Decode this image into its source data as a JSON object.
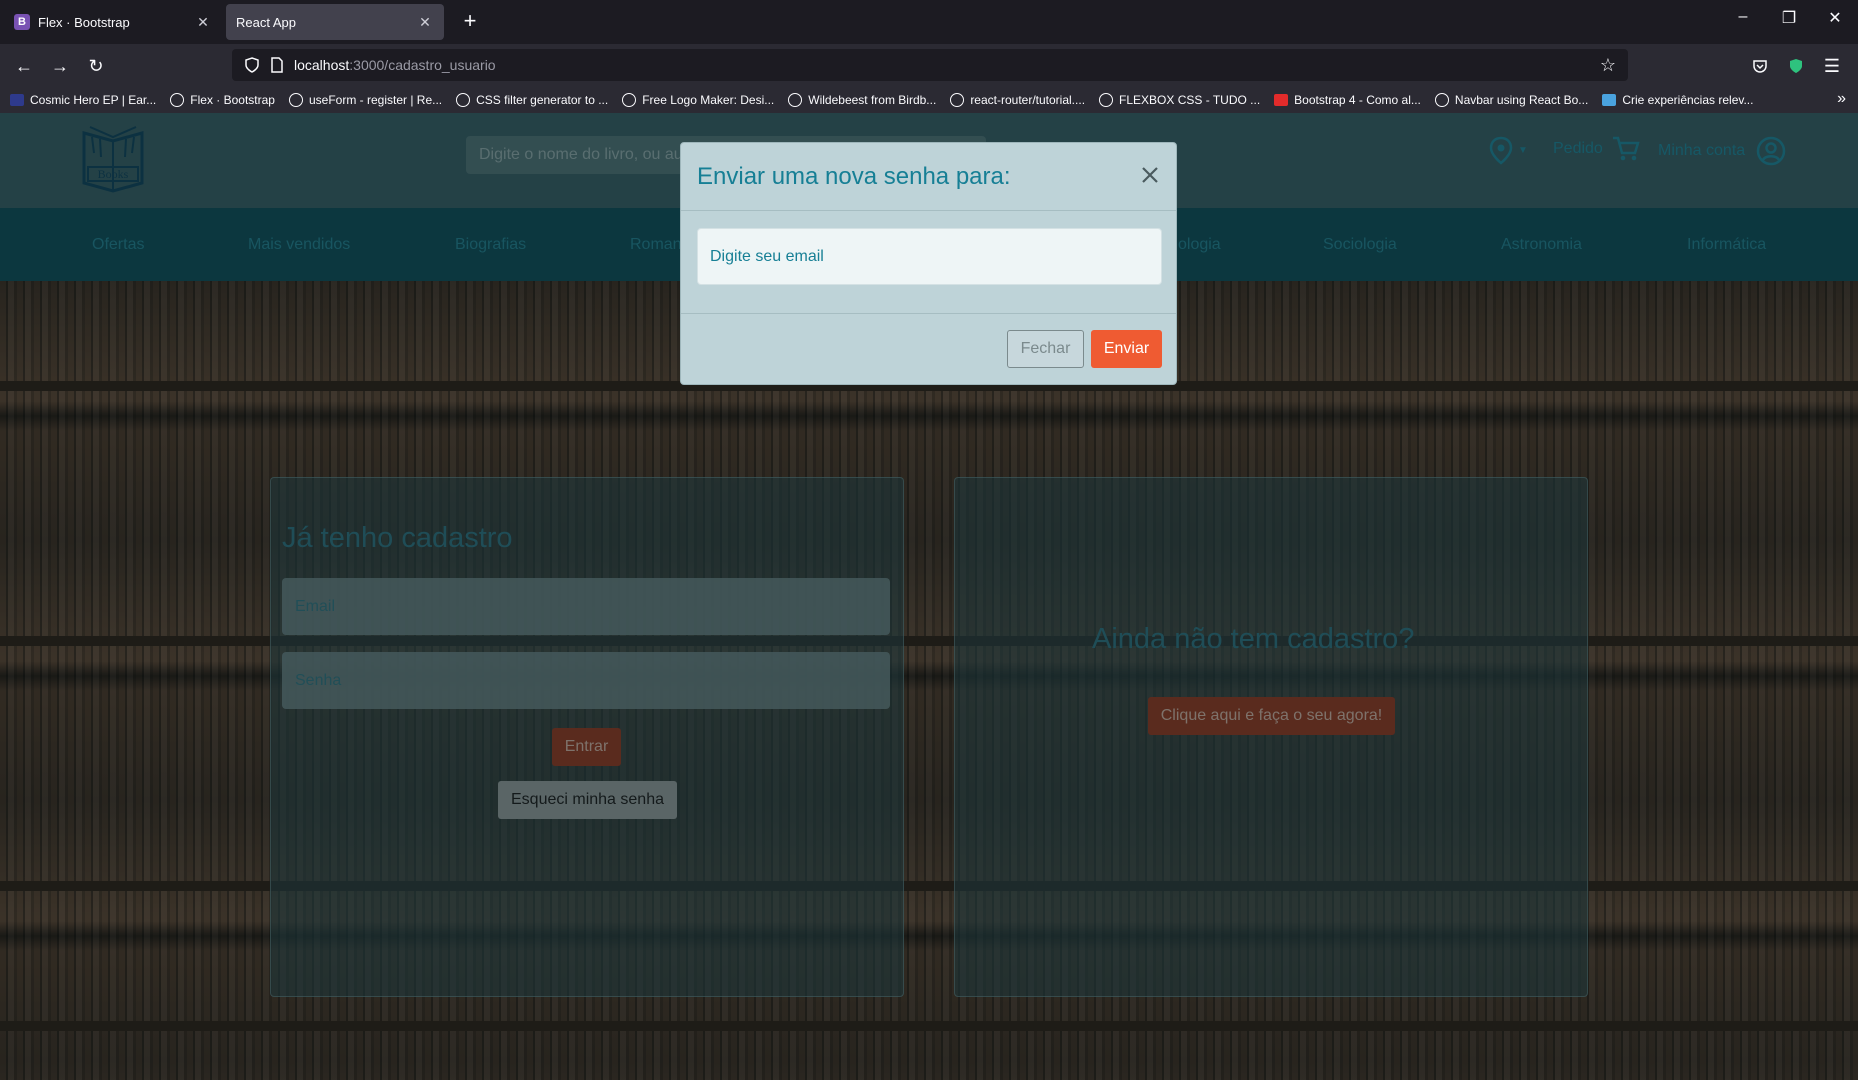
{
  "browser": {
    "tabs": [
      {
        "label": "Flex · Bootstrap",
        "favicon": "B"
      },
      {
        "label": "React App"
      }
    ],
    "url_host": "localhost",
    "url_path": ":3000/cadastro_usuario",
    "bookmarks": [
      "Cosmic Hero EP | Ear...",
      "Flex · Bootstrap",
      "useForm - register | Re...",
      "CSS filter generator to ...",
      "Free Logo Maker: Desi...",
      "Wildebeest from Birdb...",
      "react-router/tutorial....",
      "FLEXBOX CSS - TUDO ...",
      "Bootstrap 4 - Como al...",
      "Navbar using React Bo...",
      "Crie experiências relev..."
    ]
  },
  "header": {
    "logo_text": "Books",
    "search_placeholder": "Digite o nome do livro, ou au",
    "pedido": "Pedido",
    "minha_conta": "Minha conta"
  },
  "categories": [
    "Ofertas",
    "Mais vendidos",
    "Biografias",
    "Roman",
    "ologia",
    "Sociologia",
    "Astronomia",
    "Informática"
  ],
  "login": {
    "title": "Já tenho cadastro",
    "email_placeholder": "Email",
    "senha_placeholder": "Senha",
    "entrar": "Entrar",
    "esqueci": "Esqueci minha senha"
  },
  "signup": {
    "title": "Ainda não tem cadastro?",
    "button": "Clique aqui e faça o seu agora!"
  },
  "modal": {
    "title": "Enviar uma nova senha para:",
    "email_placeholder": "Digite seu email",
    "fechar": "Fechar",
    "enviar": "Enviar"
  },
  "colors": {
    "modal_accent": "#167f95",
    "enviar_button": "#ef5b32",
    "category_bar": "#0d4a55"
  }
}
